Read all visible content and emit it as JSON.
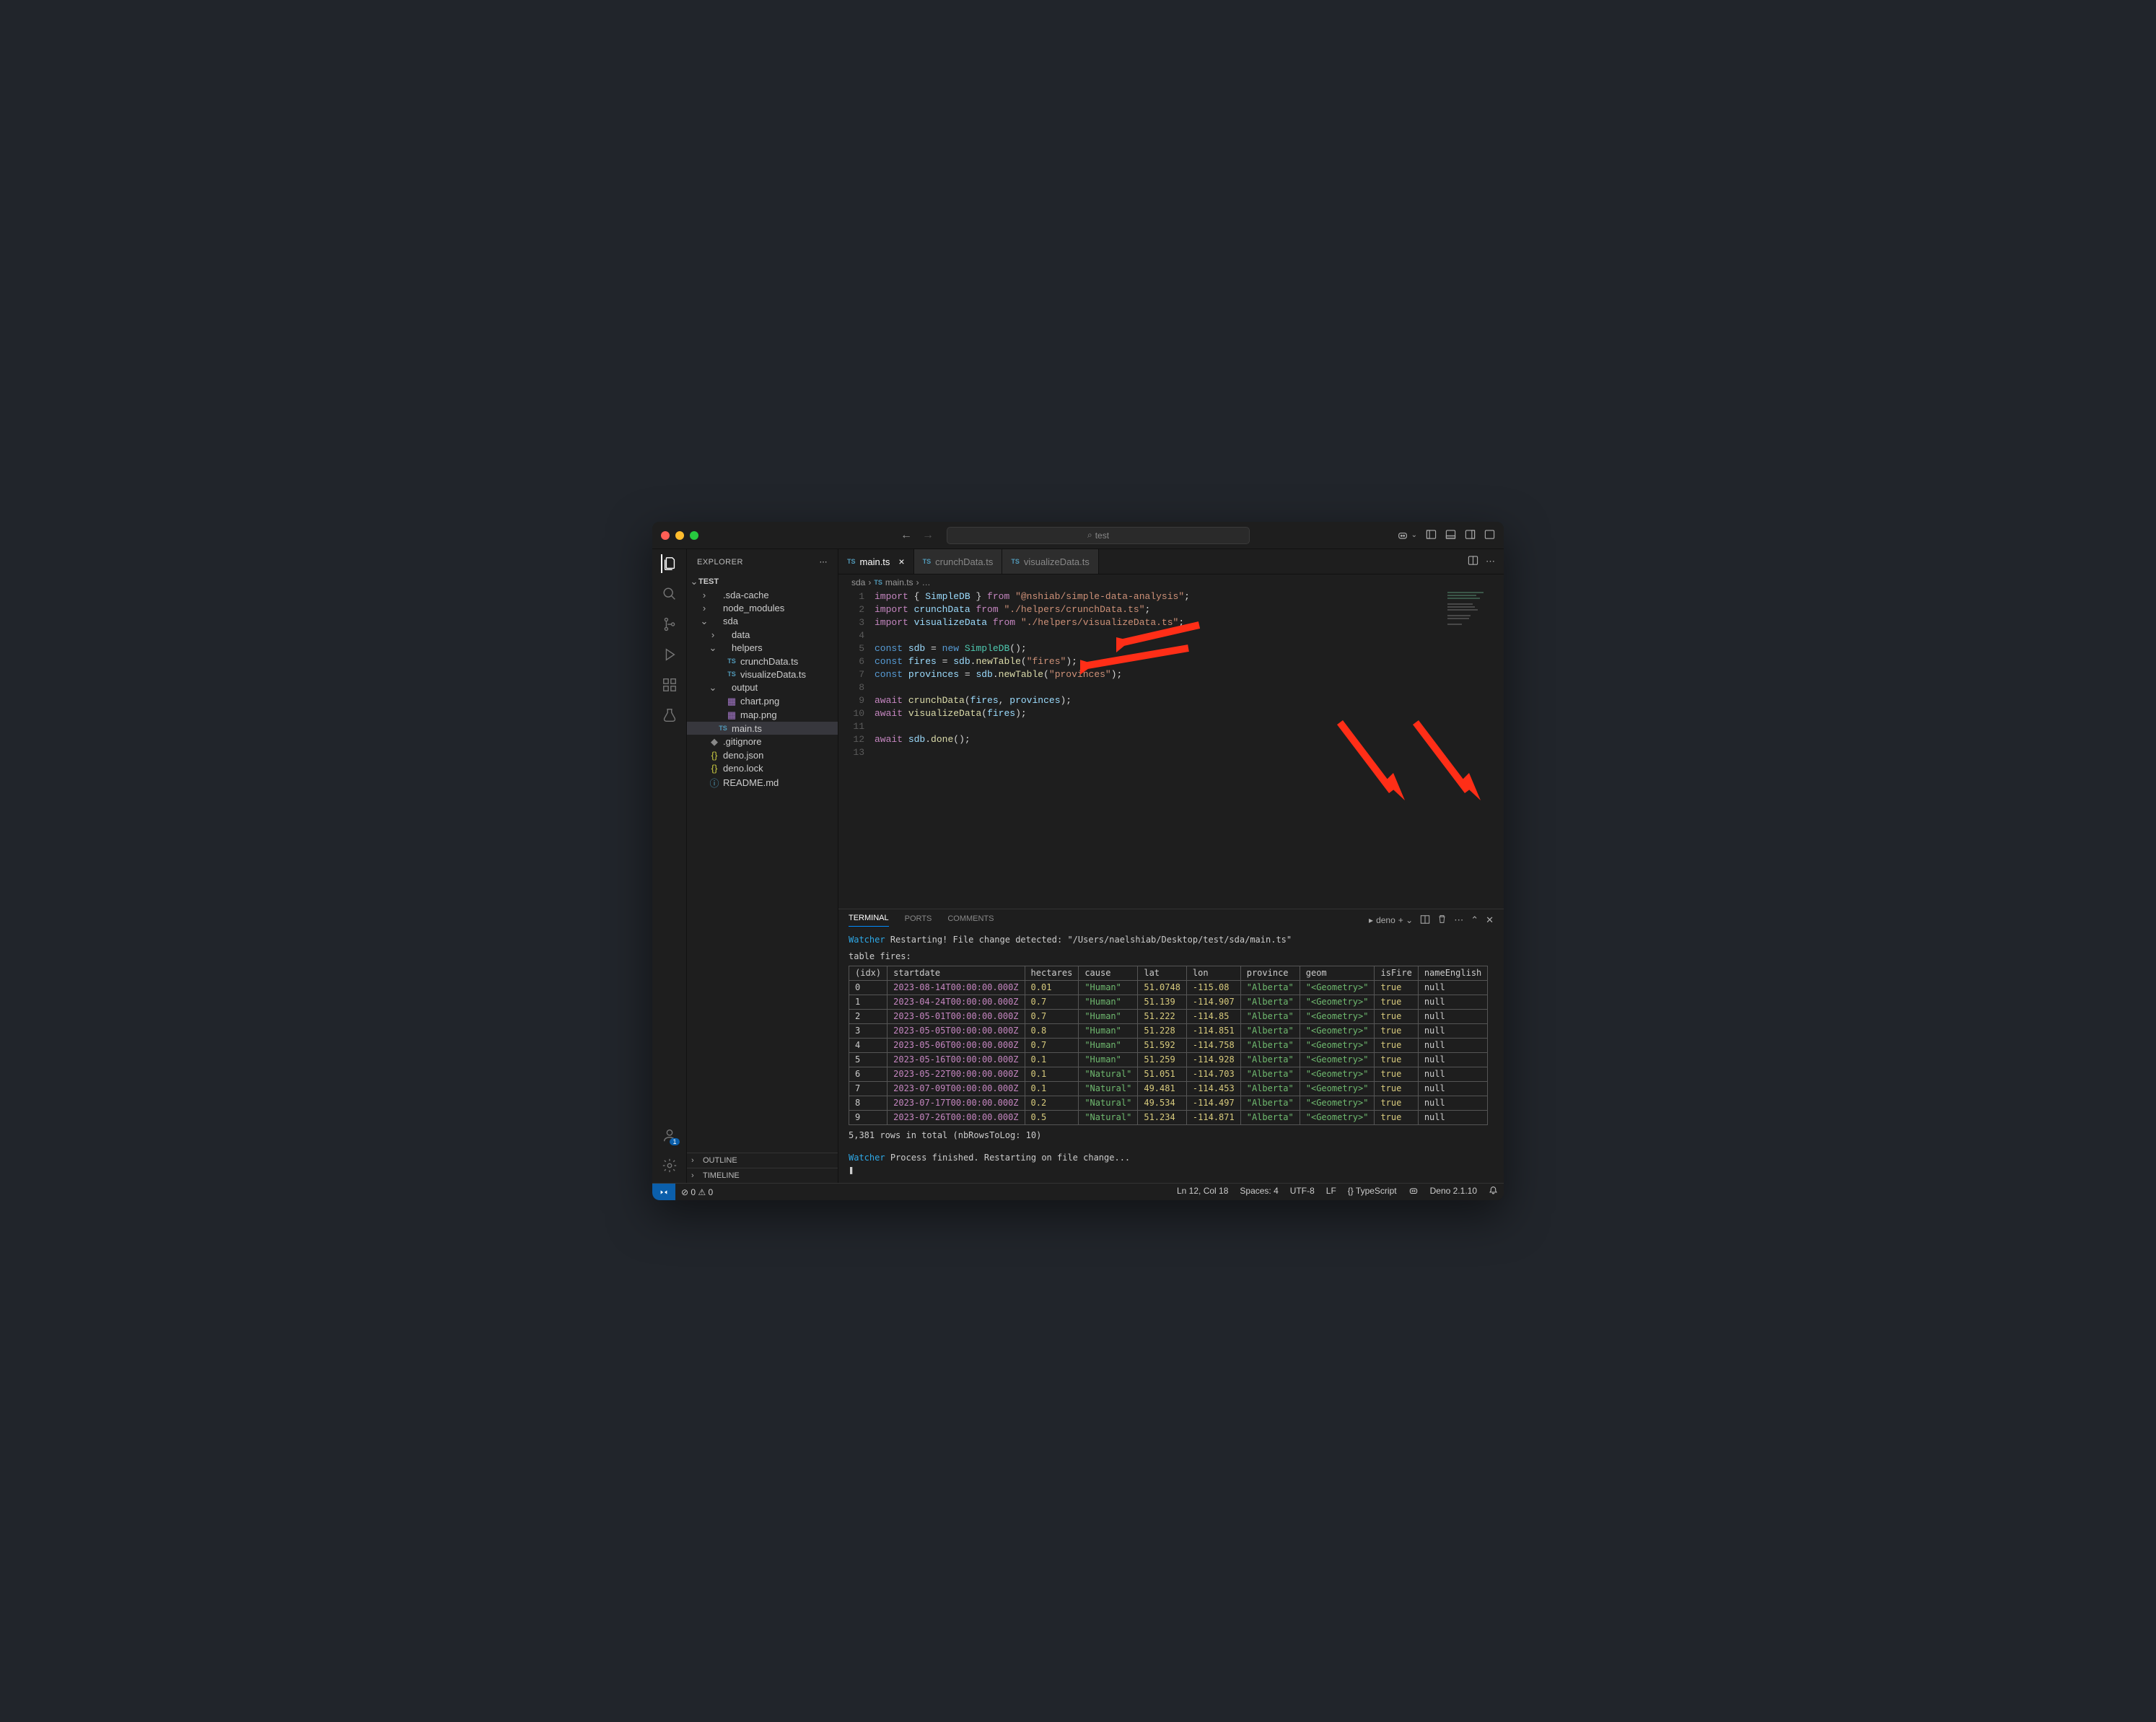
{
  "titlebar": {
    "search": "test"
  },
  "sidebar": {
    "title": "EXPLORER",
    "root": "TEST",
    "tree": [
      {
        "label": ".sda-cache",
        "depth": 1,
        "chev": "›",
        "icon": ""
      },
      {
        "label": "node_modules",
        "depth": 1,
        "chev": "›",
        "icon": ""
      },
      {
        "label": "sda",
        "depth": 1,
        "chev": "⌄",
        "icon": ""
      },
      {
        "label": "data",
        "depth": 2,
        "chev": "›",
        "icon": ""
      },
      {
        "label": "helpers",
        "depth": 2,
        "chev": "⌄",
        "icon": ""
      },
      {
        "label": "crunchData.ts",
        "depth": 3,
        "chev": "",
        "icon": "TS",
        "iconcls": "ts"
      },
      {
        "label": "visualizeData.ts",
        "depth": 3,
        "chev": "",
        "icon": "TS",
        "iconcls": "ts"
      },
      {
        "label": "output",
        "depth": 2,
        "chev": "⌄",
        "icon": ""
      },
      {
        "label": "chart.png",
        "depth": 3,
        "chev": "",
        "icon": "▦",
        "iconcls": "img"
      },
      {
        "label": "map.png",
        "depth": 3,
        "chev": "",
        "icon": "▦",
        "iconcls": "img"
      },
      {
        "label": "main.ts",
        "depth": 2,
        "chev": "",
        "icon": "TS",
        "iconcls": "ts",
        "sel": true
      },
      {
        "label": ".gitignore",
        "depth": 1,
        "chev": "",
        "icon": "◆",
        "iconcls": "gi"
      },
      {
        "label": "deno.json",
        "depth": 1,
        "chev": "",
        "icon": "{}",
        "iconcls": "js"
      },
      {
        "label": "deno.lock",
        "depth": 1,
        "chev": "",
        "icon": "{}",
        "iconcls": "js"
      },
      {
        "label": "README.md",
        "depth": 1,
        "chev": "",
        "icon": "ⓘ",
        "iconcls": "info"
      }
    ],
    "outline": "OUTLINE",
    "timeline": "TIMELINE"
  },
  "tabs": [
    {
      "label": "main.ts",
      "icon": "TS",
      "active": true,
      "close": true
    },
    {
      "label": "crunchData.ts",
      "icon": "TS",
      "active": false,
      "close": false
    },
    {
      "label": "visualizeData.ts",
      "icon": "TS",
      "active": false,
      "close": false
    }
  ],
  "breadcrumb": [
    "sda",
    "main.ts",
    "…"
  ],
  "code": {
    "lines": [
      [
        [
          "kw",
          "import"
        ],
        [
          "pn",
          " { "
        ],
        [
          "var",
          "SimpleDB"
        ],
        [
          "pn",
          " } "
        ],
        [
          "kw",
          "from"
        ],
        [
          "pn",
          " "
        ],
        [
          "str",
          "\"@nshiab/simple-data-analysis\""
        ],
        [
          "pn",
          ";"
        ]
      ],
      [
        [
          "kw",
          "import"
        ],
        [
          "pn",
          " "
        ],
        [
          "var",
          "crunchData"
        ],
        [
          "pn",
          " "
        ],
        [
          "kw",
          "from"
        ],
        [
          "pn",
          " "
        ],
        [
          "str",
          "\"./helpers/crunchData.ts\""
        ],
        [
          "pn",
          ";"
        ]
      ],
      [
        [
          "kw",
          "import"
        ],
        [
          "pn",
          " "
        ],
        [
          "var",
          "visualizeData"
        ],
        [
          "pn",
          " "
        ],
        [
          "kw",
          "from"
        ],
        [
          "pn",
          " "
        ],
        [
          "str",
          "\"./helpers/visualizeData.ts\""
        ],
        [
          "pn",
          ";"
        ]
      ],
      [],
      [
        [
          "new",
          "const"
        ],
        [
          "pn",
          " "
        ],
        [
          "var",
          "sdb"
        ],
        [
          "pn",
          " = "
        ],
        [
          "new",
          "new"
        ],
        [
          "pn",
          " "
        ],
        [
          "cls",
          "SimpleDB"
        ],
        [
          "pn",
          "();"
        ]
      ],
      [
        [
          "new",
          "const"
        ],
        [
          "pn",
          " "
        ],
        [
          "var",
          "fires"
        ],
        [
          "pn",
          " = "
        ],
        [
          "var",
          "sdb"
        ],
        [
          "pn",
          "."
        ],
        [
          "fn",
          "newTable"
        ],
        [
          "pn",
          "("
        ],
        [
          "str",
          "\"fires\""
        ],
        [
          "pn",
          ");"
        ]
      ],
      [
        [
          "new",
          "const"
        ],
        [
          "pn",
          " "
        ],
        [
          "var",
          "provinces"
        ],
        [
          "pn",
          " = "
        ],
        [
          "var",
          "sdb"
        ],
        [
          "pn",
          "."
        ],
        [
          "fn",
          "newTable"
        ],
        [
          "pn",
          "("
        ],
        [
          "str",
          "\"provinces\""
        ],
        [
          "pn",
          ");"
        ]
      ],
      [],
      [
        [
          "kw",
          "await"
        ],
        [
          "pn",
          " "
        ],
        [
          "fn",
          "crunchData"
        ],
        [
          "pn",
          "("
        ],
        [
          "var",
          "fires"
        ],
        [
          "pn",
          ", "
        ],
        [
          "var",
          "provinces"
        ],
        [
          "pn",
          ");"
        ]
      ],
      [
        [
          "kw",
          "await"
        ],
        [
          "pn",
          " "
        ],
        [
          "fn",
          "visualizeData"
        ],
        [
          "pn",
          "("
        ],
        [
          "var",
          "fires"
        ],
        [
          "pn",
          ");"
        ]
      ],
      [],
      [
        [
          "kw",
          "await"
        ],
        [
          "pn",
          " "
        ],
        [
          "var",
          "sdb"
        ],
        [
          "pn",
          "."
        ],
        [
          "fn",
          "done"
        ],
        [
          "pn",
          "();"
        ]
      ],
      []
    ]
  },
  "panel": {
    "tabs": [
      "TERMINAL",
      "PORTS",
      "COMMENTS"
    ],
    "shell": "deno",
    "watcher1": "Restarting! File change detected: ",
    "watcherPath": "\"/Users/naelshiab/Desktop/test/sda/main.ts\"",
    "tableName": "table fires:",
    "headers": [
      "(idx)",
      "startdate",
      "hectares",
      "cause",
      "lat",
      "lon",
      "province",
      "geom",
      "isFire",
      "nameEnglish"
    ],
    "rows": [
      [
        "0",
        "2023-08-14T00:00:00.000Z",
        "0.01",
        "\"Human\"",
        "51.0748",
        "-115.08",
        "\"Alberta\"",
        "\"<Geometry>\"",
        "true",
        "null"
      ],
      [
        "1",
        "2023-04-24T00:00:00.000Z",
        "0.7",
        "\"Human\"",
        "51.139",
        "-114.907",
        "\"Alberta\"",
        "\"<Geometry>\"",
        "true",
        "null"
      ],
      [
        "2",
        "2023-05-01T00:00:00.000Z",
        "0.7",
        "\"Human\"",
        "51.222",
        "-114.85",
        "\"Alberta\"",
        "\"<Geometry>\"",
        "true",
        "null"
      ],
      [
        "3",
        "2023-05-05T00:00:00.000Z",
        "0.8",
        "\"Human\"",
        "51.228",
        "-114.851",
        "\"Alberta\"",
        "\"<Geometry>\"",
        "true",
        "null"
      ],
      [
        "4",
        "2023-05-06T00:00:00.000Z",
        "0.7",
        "\"Human\"",
        "51.592",
        "-114.758",
        "\"Alberta\"",
        "\"<Geometry>\"",
        "true",
        "null"
      ],
      [
        "5",
        "2023-05-16T00:00:00.000Z",
        "0.1",
        "\"Human\"",
        "51.259",
        "-114.928",
        "\"Alberta\"",
        "\"<Geometry>\"",
        "true",
        "null"
      ],
      [
        "6",
        "2023-05-22T00:00:00.000Z",
        "0.1",
        "\"Natural\"",
        "51.051",
        "-114.703",
        "\"Alberta\"",
        "\"<Geometry>\"",
        "true",
        "null"
      ],
      [
        "7",
        "2023-07-09T00:00:00.000Z",
        "0.1",
        "\"Natural\"",
        "49.481",
        "-114.453",
        "\"Alberta\"",
        "\"<Geometry>\"",
        "true",
        "null"
      ],
      [
        "8",
        "2023-07-17T00:00:00.000Z",
        "0.2",
        "\"Natural\"",
        "49.534",
        "-114.497",
        "\"Alberta\"",
        "\"<Geometry>\"",
        "true",
        "null"
      ],
      [
        "9",
        "2023-07-26T00:00:00.000Z",
        "0.5",
        "\"Natural\"",
        "51.234",
        "-114.871",
        "\"Alberta\"",
        "\"<Geometry>\"",
        "true",
        "null"
      ]
    ],
    "summary": "5,381 rows in total (nbRowsToLog: 10)",
    "watcher2": "Process finished. Restarting on file change...",
    "cursor": "❚"
  },
  "statusbar": {
    "errors": "⊘ 0 ⚠ 0",
    "pos": "Ln 12, Col 18",
    "spaces": "Spaces: 4",
    "encoding": "UTF-8",
    "eol": "LF",
    "lang": "{} TypeScript",
    "runtime": "Deno 2.1.10"
  }
}
